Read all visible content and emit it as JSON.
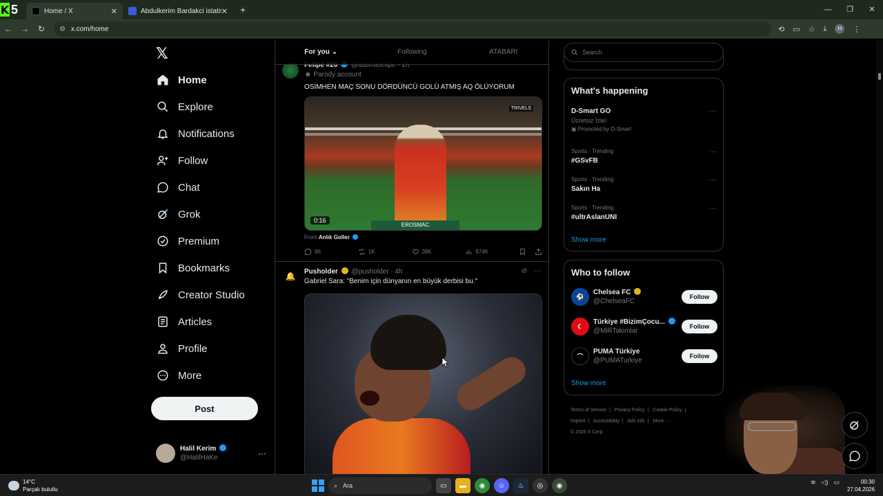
{
  "browser": {
    "kick_logo": "K",
    "kick_number": "5",
    "tabs": [
      {
        "title": "Home / X",
        "active": true
      },
      {
        "title": "Abdulkerim Bardakci istatistikle",
        "active": false
      }
    ],
    "url": "x.com/home",
    "profile_initial": "H",
    "window_controls": [
      "—",
      "❐",
      "✕"
    ]
  },
  "nav": {
    "logo": "𝕏",
    "items": [
      {
        "label": "Home",
        "icon": "home-icon"
      },
      {
        "label": "Explore",
        "icon": "search-icon"
      },
      {
        "label": "Notifications",
        "icon": "bell-icon"
      },
      {
        "label": "Follow",
        "icon": "person-plus-icon"
      },
      {
        "label": "Chat",
        "icon": "chat-bubble-icon"
      },
      {
        "label": "Grok",
        "icon": "grok-icon"
      },
      {
        "label": "Premium",
        "icon": "premium-icon"
      },
      {
        "label": "Bookmarks",
        "icon": "bookmark-icon"
      },
      {
        "label": "Creator Studio",
        "icon": "rocket-icon"
      },
      {
        "label": "Articles",
        "icon": "article-icon"
      },
      {
        "label": "Profile",
        "icon": "person-icon"
      },
      {
        "label": "More",
        "icon": "more-circle-icon"
      }
    ],
    "post_label": "Post",
    "account": {
      "name": "Halil Kerim",
      "handle": "@HalilHaKe",
      "more": "···"
    }
  },
  "feed": {
    "tabs": [
      {
        "label": "For you",
        "selected": true
      },
      {
        "label": "Following",
        "selected": false
      },
      {
        "label": "ATABARI",
        "selected": false
      }
    ],
    "tweet1": {
      "name": "Felipe #26",
      "handle": "@atavratfelipe · 2h",
      "label": "Parody account",
      "text": "OSİMHEN MAÇ SONU DÖRDÜNCÜ GOLÜ ATMIŞ AQ ÖLÜYORUM",
      "video_duration": "0:16",
      "video_badge": "TRIVELS",
      "sponsor": "EROSMAC",
      "from_prefix": "From",
      "from_name": "Anlık Goller",
      "stats": {
        "replies": "96",
        "reposts": "1K",
        "likes": "38K",
        "views": "974K"
      }
    },
    "tweet2": {
      "name": "Pusholder",
      "handle": "@pusholder · 4h",
      "text": "Gabriel Sara: \"Benim için dünyanın en büyük derbisi bu.\""
    }
  },
  "sidebar": {
    "search_placeholder": "Search",
    "happening_title": "What's happening",
    "trends": [
      {
        "meta": "",
        "title": "D-Smart GO",
        "sub": "Ücretsiz İzle!",
        "promo": "Promoted by D-Smart"
      },
      {
        "meta": "Sports · Trending",
        "title": "#GSvFB",
        "sub": "",
        "promo": ""
      },
      {
        "meta": "Sports · Trending",
        "title": "Sakın Ha",
        "sub": "",
        "promo": ""
      },
      {
        "meta": "Sports · Trending",
        "title": "#ultrAslanUNI",
        "sub": "",
        "promo": ""
      }
    ],
    "show_more": "Show more",
    "who_to_follow_title": "Who to follow",
    "follow": [
      {
        "name": "Chelsea FC",
        "handle": "@ChelseaFC",
        "button": "Follow",
        "color": "#0a4595"
      },
      {
        "name": "Türkiye #BizimÇocu...",
        "handle": "@MilliTakimlar",
        "button": "Follow",
        "color": "#e30a17"
      },
      {
        "name": "PUMA Türkiye",
        "handle": "@PUMATurkiye",
        "button": "Follow",
        "color": "#000000"
      }
    ],
    "footer": {
      "line1": [
        "Terms of Service",
        "|",
        "Privacy Policy",
        "|",
        "Cookie Policy",
        "|"
      ],
      "line2": [
        "Imprint",
        "|",
        "Accessibility",
        "|",
        "Ads info",
        "|",
        "More ···"
      ],
      "copyright": "© 2026 X Corp."
    }
  },
  "taskbar": {
    "temperature": "14°C",
    "weather": "Parçalı bulutlu",
    "search": "Ara",
    "time": "00:30",
    "date": "27.04.2026"
  },
  "colors": {
    "accent": "#1d9bf0",
    "verified_gold": "#e2b719",
    "kick_green": "#53fc18",
    "border": "#2f3336"
  }
}
